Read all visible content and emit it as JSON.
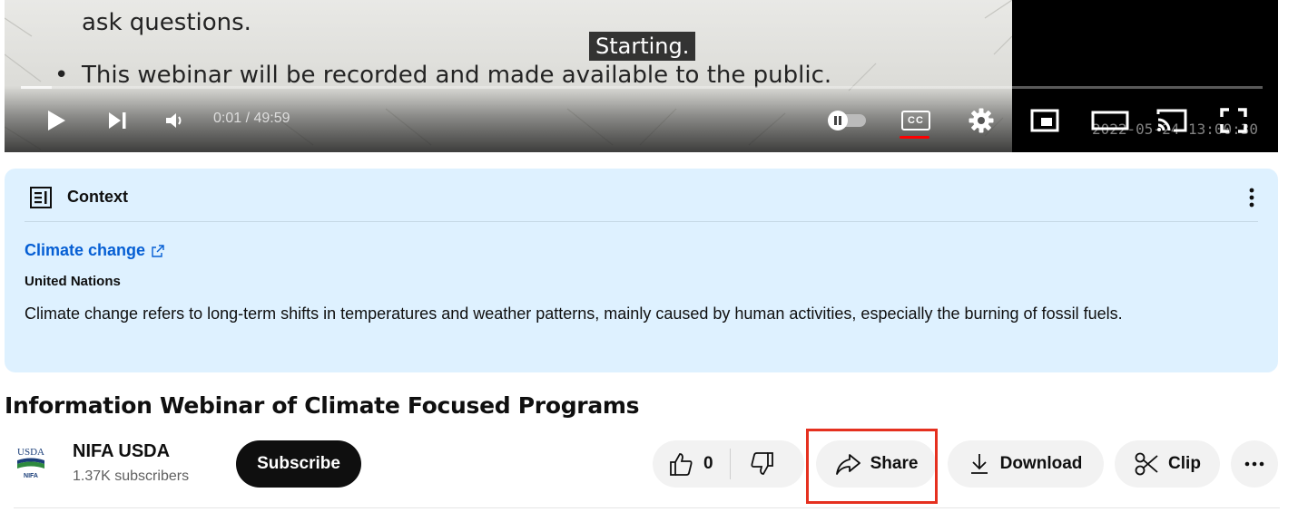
{
  "player": {
    "slide_line1": "ask questions.",
    "slide_bullet": "This webinar will be recorded and made available to the public.",
    "bullet_char": "•",
    "caption": "Starting.",
    "time_display": "0:01 / 49:59",
    "timestamp_overlay": "2022-05-24 13:00:30",
    "progress_loaded_fraction": 0.025,
    "cc_label": "CC",
    "controls": [
      "play-icon",
      "next-icon",
      "volume-icon",
      "autoplay-toggle",
      "subtitles-icon",
      "settings-icon",
      "miniplayer-icon",
      "theater-icon",
      "cast-icon",
      "fullscreen-icon"
    ]
  },
  "context": {
    "header": "Context",
    "link_text": "Climate change",
    "source": "United Nations",
    "body": "Climate change refers to long-term shifts in temperatures and weather patterns, mainly caused by human activities, especially the burning of fossil fuels."
  },
  "video": {
    "title": "Information Webinar of Climate Focused Programs"
  },
  "channel": {
    "name": "NIFA USDA",
    "subscribers": "1.37K subscribers",
    "avatar_top": "USDA",
    "avatar_bottom": "NIFA",
    "subscribe_label": "Subscribe"
  },
  "actions": {
    "like_count": "0",
    "share_label": "Share",
    "download_label": "Download",
    "clip_label": "Clip",
    "more_icon": "more-horizontal-icon"
  },
  "colors": {
    "accent_red": "#ff0000",
    "link_blue": "#065fd4",
    "context_bg": "#def1ff",
    "highlight": "#e5301f"
  }
}
